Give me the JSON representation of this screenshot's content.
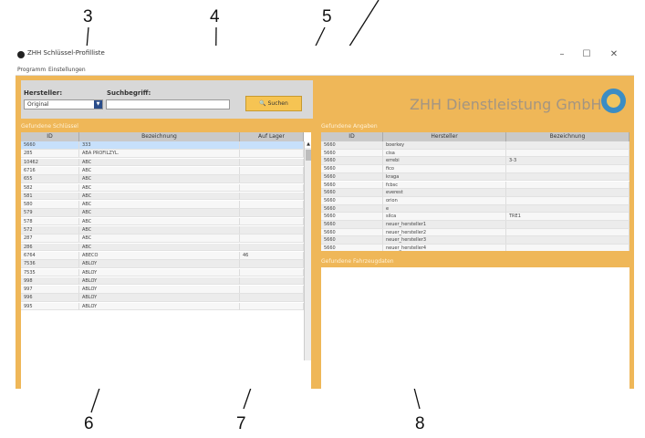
{
  "callouts": [
    "3",
    "4",
    "5",
    "6",
    "7",
    "8"
  ],
  "window": {
    "title": "ZHH Schlüssel-Profilliste",
    "controls": {
      "minimize": "–",
      "maximize": "☐",
      "close": "✕"
    }
  },
  "menu": {
    "items": [
      "Programm",
      "Einstellungen"
    ]
  },
  "search": {
    "manufacturer_label": "Hersteller:",
    "manufacturer_value": "Original",
    "term_label": "Suchbegriff:",
    "term_value": "",
    "button_label": "Suchen"
  },
  "company_logo_text": "ZHH Dienstleistung GmbH",
  "profiles": {
    "section_title": "Gefundene Schlüssel",
    "columns": [
      "ID",
      "Bezeichnung",
      "Auf Lager"
    ],
    "rows": [
      [
        "5660",
        "333",
        ""
      ],
      [
        "285",
        "ABA PROFILZYL.",
        ""
      ],
      [
        "10462",
        "ABC",
        ""
      ],
      [
        "6716",
        "ABC",
        ""
      ],
      [
        "655",
        "ABC",
        ""
      ],
      [
        "582",
        "ABC",
        ""
      ],
      [
        "581",
        "ABC",
        ""
      ],
      [
        "580",
        "ABC",
        ""
      ],
      [
        "579",
        "ABC",
        ""
      ],
      [
        "578",
        "ABC",
        ""
      ],
      [
        "572",
        "ABC",
        ""
      ],
      [
        "287",
        "ABC",
        ""
      ],
      [
        "286",
        "ABC",
        ""
      ],
      [
        "6764",
        "ABECO",
        "46"
      ],
      [
        "7536",
        "ABLOY",
        ""
      ],
      [
        "7535",
        "ABLOY",
        ""
      ],
      [
        "998",
        "ABLOY",
        ""
      ],
      [
        "997",
        "ABLOY",
        ""
      ],
      [
        "996",
        "ABLOY",
        ""
      ],
      [
        "995",
        "ABLOY",
        ""
      ]
    ]
  },
  "references": {
    "section_title": "Gefundene Angaben",
    "columns": [
      "ID",
      "Hersteller",
      "Bezeichnung"
    ],
    "rows": [
      [
        "5660",
        "boerkey",
        ""
      ],
      [
        "5660",
        "cisa",
        ""
      ],
      [
        "5660",
        "errebi",
        "3-3"
      ],
      [
        "5660",
        "fico",
        ""
      ],
      [
        "5660",
        "kraga",
        ""
      ],
      [
        "5660",
        "fcbsc",
        ""
      ],
      [
        "5660",
        "everest",
        ""
      ],
      [
        "5660",
        "orion",
        ""
      ],
      [
        "5660",
        "e",
        ""
      ],
      [
        "5660",
        "silca",
        "TRE1"
      ],
      [
        "5660",
        "neuer_hersteller1",
        ""
      ],
      [
        "5660",
        "neuer_hersteller2",
        ""
      ],
      [
        "5660",
        "neuer_hersteller3",
        ""
      ],
      [
        "5660",
        "neuer_hersteller4",
        ""
      ]
    ]
  },
  "images": {
    "section_title": "Gefundene Fahrzeugdaten"
  }
}
